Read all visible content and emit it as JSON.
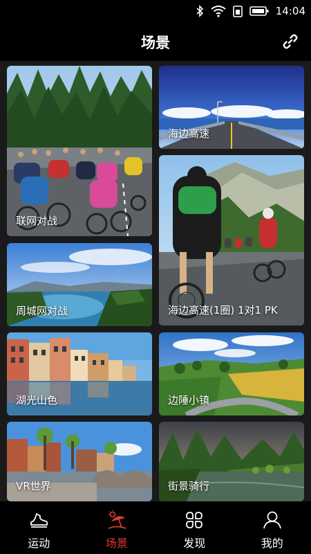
{
  "status_bar": {
    "time": "14:04",
    "icons": [
      "bluetooth-icon",
      "wifi-icon",
      "sim-icon",
      "battery-icon"
    ]
  },
  "header": {
    "title": "场景",
    "action_icon": "link-icon"
  },
  "scenes": [
    {
      "id": "lianwang",
      "label": "联网对战"
    },
    {
      "id": "haibian",
      "label": "海边高速"
    },
    {
      "id": "pk",
      "label": "海边高速(1圈) 1对1 PK"
    },
    {
      "id": "zhoucheng",
      "label": "周城网对战"
    },
    {
      "id": "huguang",
      "label": "湖光山色"
    },
    {
      "id": "bianchui",
      "label": "边陲小镇"
    },
    {
      "id": "vr",
      "label": "VR世界"
    },
    {
      "id": "jiejing",
      "label": "街景骑行"
    }
  ],
  "tabs": [
    {
      "label": "运动",
      "icon": "sneaker-icon",
      "active": false
    },
    {
      "label": "场景",
      "icon": "beach-umbrella-icon",
      "active": true
    },
    {
      "label": "发现",
      "icon": "grid-petals-icon",
      "active": false
    },
    {
      "label": "我的",
      "icon": "person-icon",
      "active": false
    }
  ],
  "colors": {
    "accent": "#e03a2f",
    "background": "#1a1a1a",
    "bar": "#000000"
  }
}
